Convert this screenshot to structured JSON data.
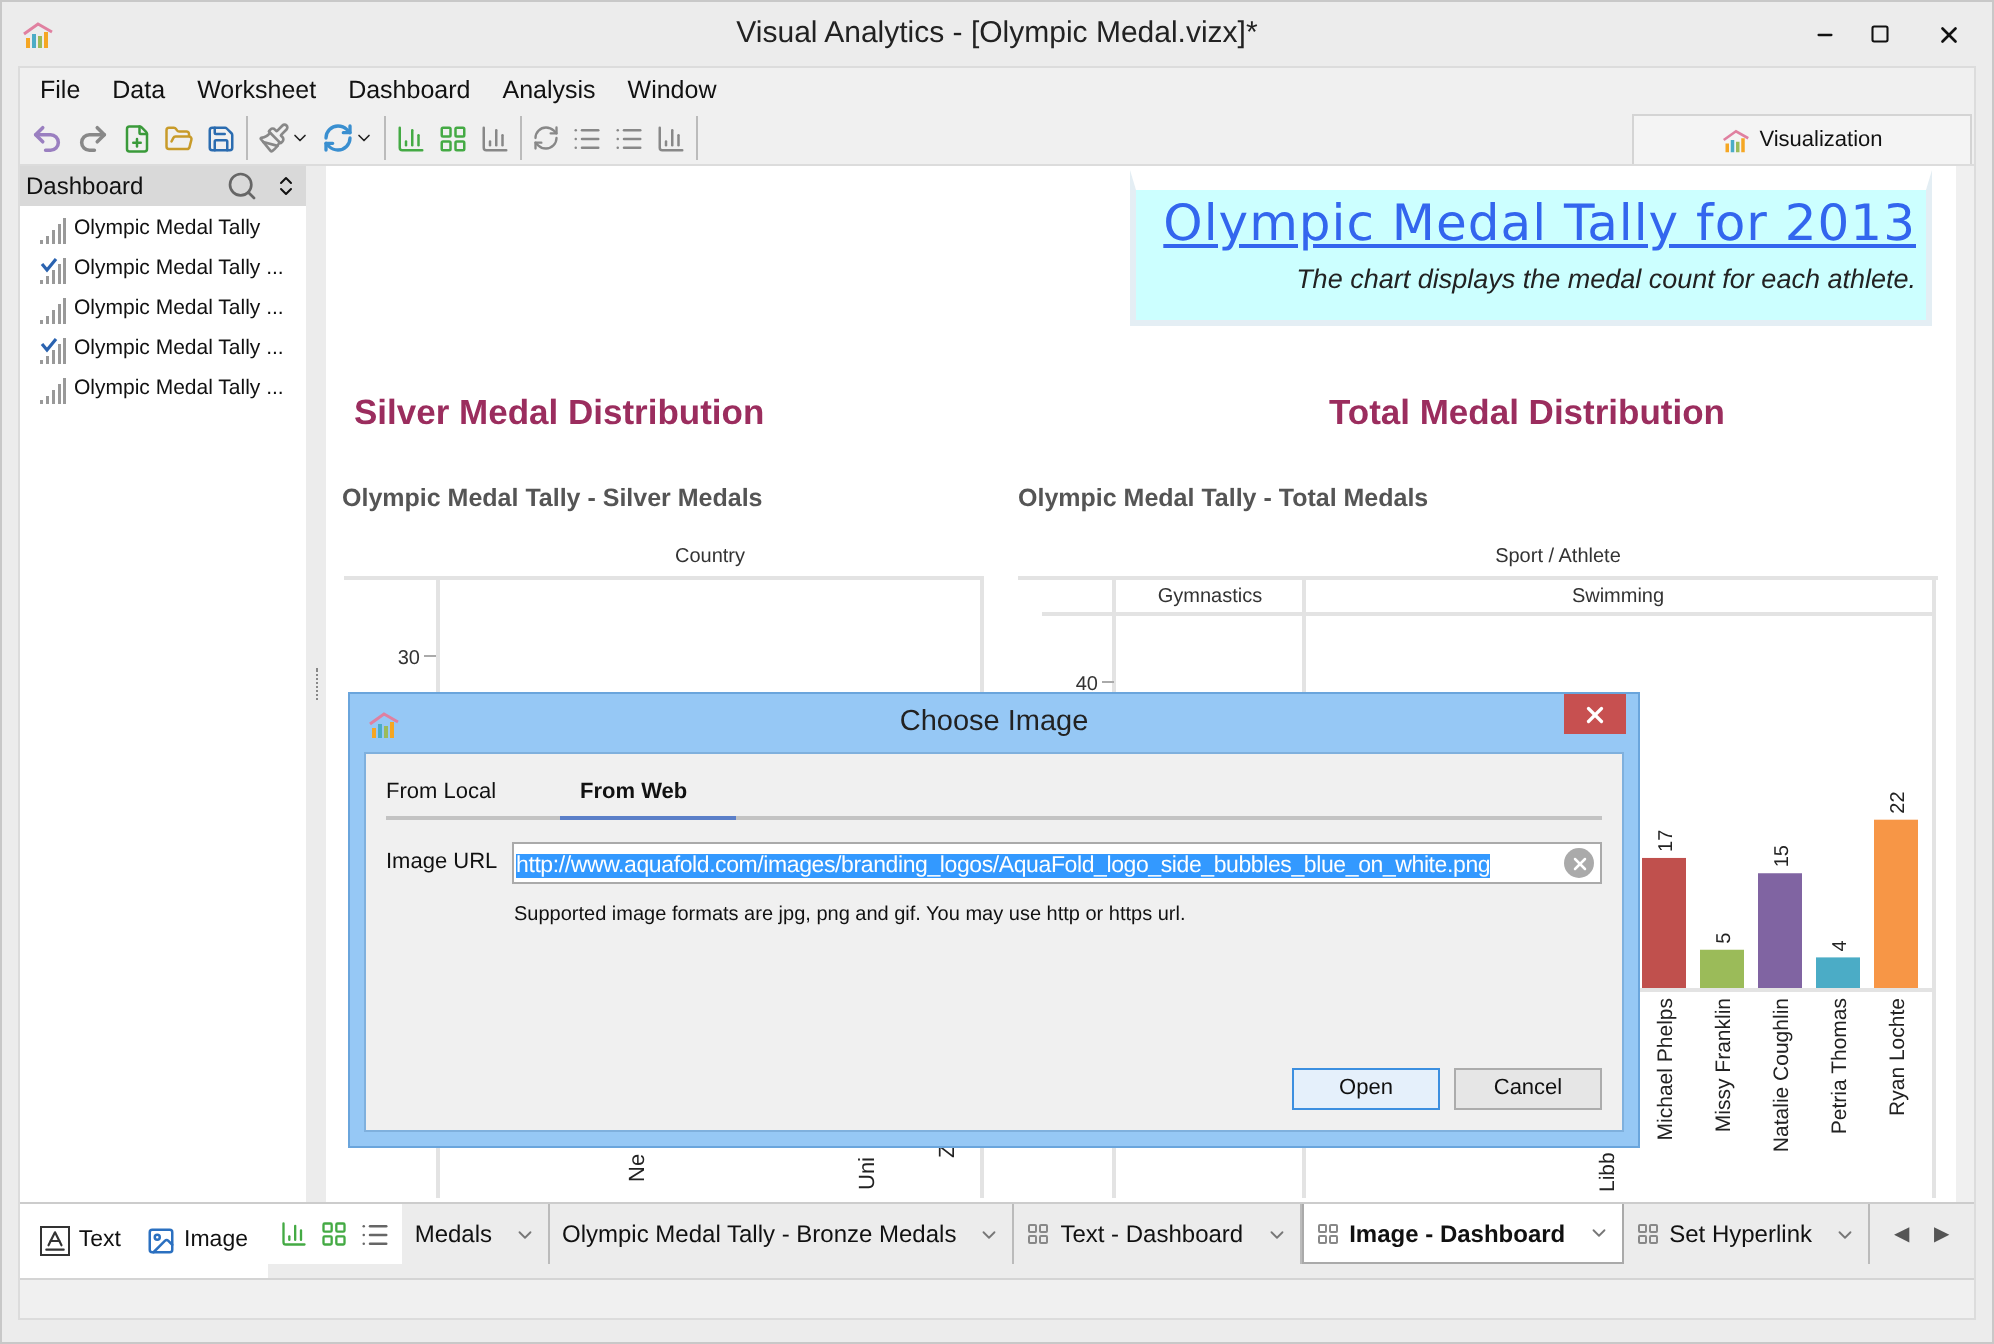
{
  "window": {
    "title": "Visual Analytics - [Olympic Medal.vizx]*"
  },
  "menu": [
    "File",
    "Data",
    "Worksheet",
    "Dashboard",
    "Analysis",
    "Window"
  ],
  "right_tab": {
    "label": "Visualization"
  },
  "sidebar": {
    "title": "Dashboard",
    "items": [
      {
        "label": "Olympic Medal Tally",
        "kind": "chart"
      },
      {
        "label": "Olympic Medal Tally ...",
        "kind": "chart-check"
      },
      {
        "label": "Olympic Medal Tally ...",
        "kind": "chart"
      },
      {
        "label": "Olympic Medal Tally ...",
        "kind": "chart-check"
      },
      {
        "label": "Olympic Medal Tally ..."
      }
    ],
    "tools": [
      {
        "label": "Text",
        "kind": "text"
      },
      {
        "label": "Image",
        "kind": "image"
      }
    ]
  },
  "banner": {
    "title": "Olympic Medal Tally for 2013",
    "subtitle": "The chart displays the medal count for each athlete."
  },
  "sections": [
    "Silver Medal Distribution",
    "Total Medal Distribution"
  ],
  "silver_chart": {
    "title": "Olympic Medal Tally - Silver Medals",
    "axis_title": "Country",
    "y_ticks": [
      "30"
    ],
    "x_labels": [
      "Ne",
      "Uni",
      "Z"
    ]
  },
  "total_chart": {
    "title": "Olympic Medal Tally - Total Medals",
    "axis_title": "Sport / Athlete",
    "panels": [
      "Gymnastics",
      "Swimming"
    ],
    "y_ticks": [
      "40"
    ],
    "cut_labels": [
      "Libb"
    ],
    "bars": [
      {
        "label": "Michael Phelps",
        "value": "17",
        "color": "#c0504d"
      },
      {
        "label": "Missy Franklin",
        "value": "5",
        "color": "#9bbb59"
      },
      {
        "label": "Natalie Coughlin",
        "value": "15",
        "color": "#8064a2"
      },
      {
        "label": "Petria Thomas",
        "value": "4",
        "color": "#4bacc6"
      },
      {
        "label": "Ryan Lochte",
        "value": "22",
        "color": "#f79646"
      }
    ]
  },
  "dialog": {
    "title": "Choose Image",
    "tabs": [
      {
        "label": "From Local",
        "selected": false
      },
      {
        "label": "From Web",
        "selected": true
      }
    ],
    "field_label": "Image URL",
    "url": "http://www.aquafold.com/images/branding_logos/AquaFold_logo_side_bubbles_blue_on_white.png",
    "hint": "Supported image formats are jpg, png and gif. You may use http or https url.",
    "buttons": [
      {
        "label": "Open",
        "kind": "default"
      },
      {
        "label": "Cancel",
        "kind": "normal"
      }
    ]
  },
  "bottom_tabs": [
    {
      "label": "Medals",
      "kind": "sheet",
      "selected": false
    },
    {
      "label": "Olympic Medal Tally - Bronze Medals",
      "kind": "sheet",
      "selected": false
    },
    {
      "label": "Text - Dashboard",
      "kind": "dashboard",
      "selected": false
    },
    {
      "label": "Image - Dashboard",
      "kind": "dashboard",
      "selected": true
    },
    {
      "label": "Set Hyperlink",
      "kind": "dashboard",
      "selected": false
    }
  ],
  "tab_nav": [
    "◀",
    "▶"
  ]
}
